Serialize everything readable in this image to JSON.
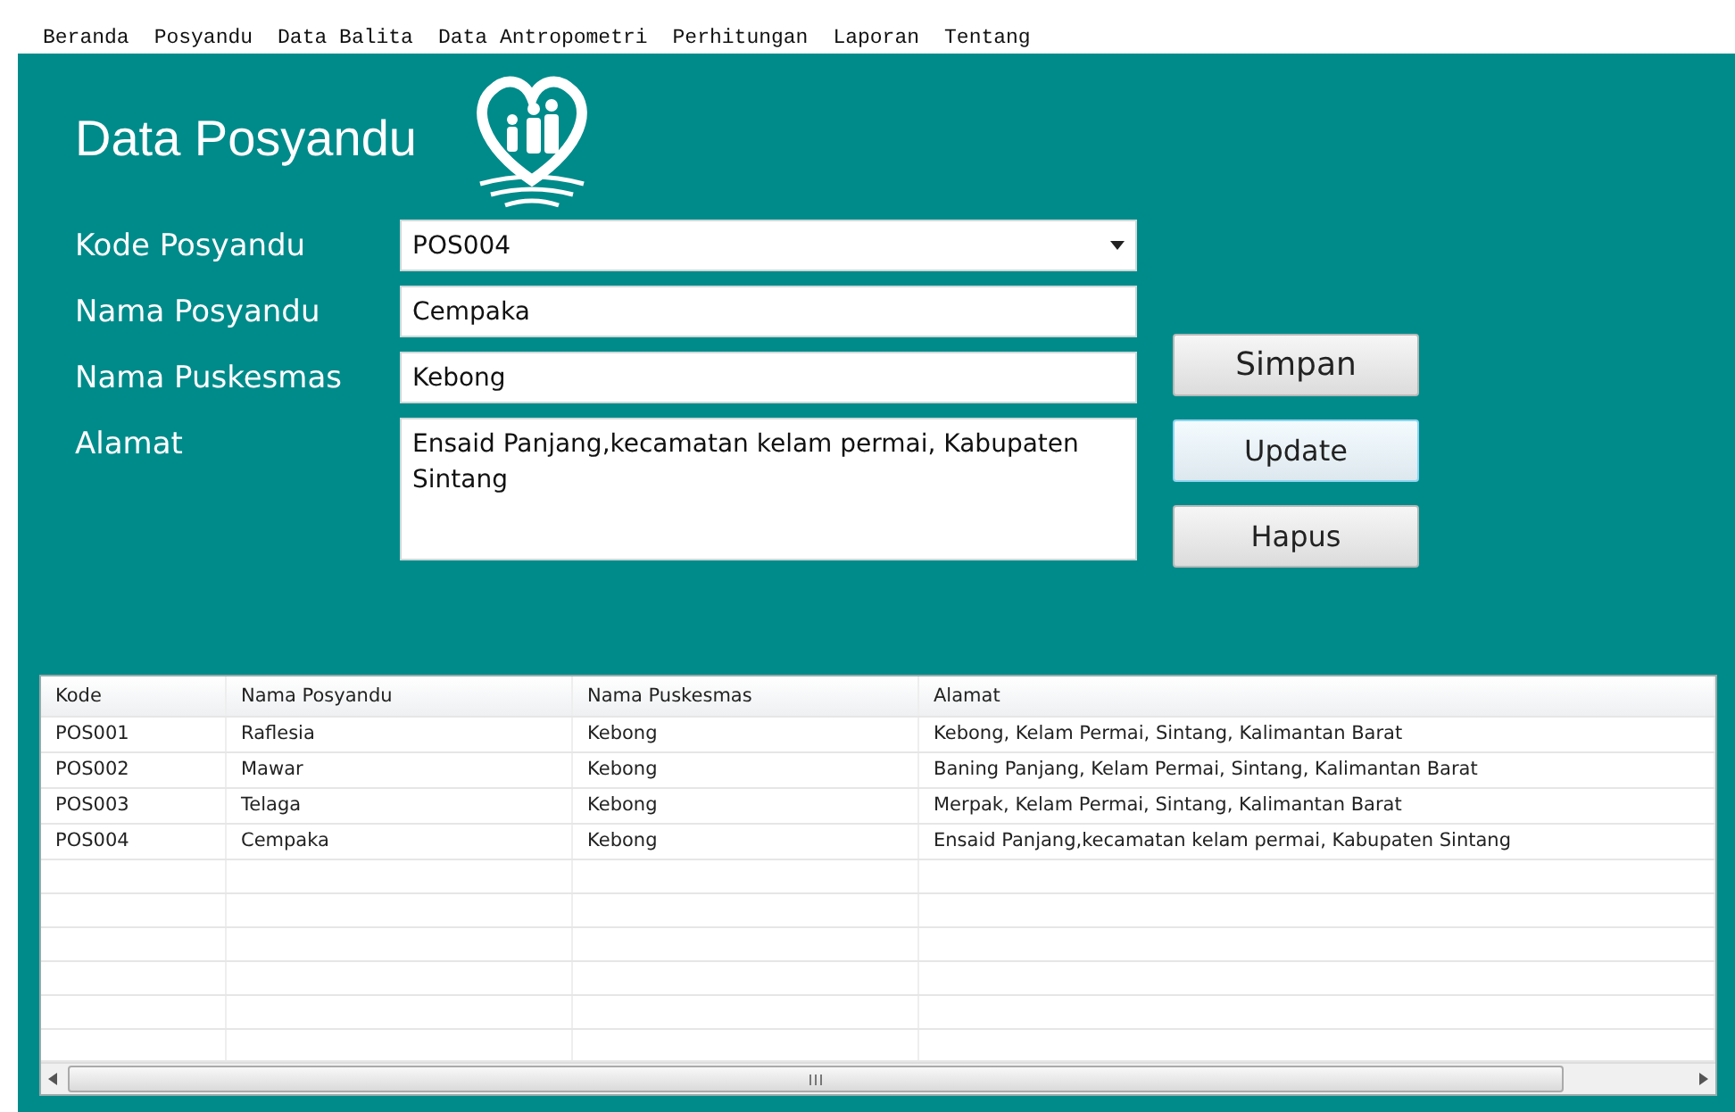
{
  "menu": [
    "Beranda",
    "Posyandu",
    "Data Balita",
    "Data Antropometri",
    "Perhitungan",
    "Laporan",
    "Tentang"
  ],
  "title": "Data Posyandu",
  "form": [
    {
      "label": "Kode Posyandu",
      "kind": "dropdown",
      "value": "POS004"
    },
    {
      "label": "Nama Posyandu",
      "kind": "text",
      "value": "Cempaka"
    },
    {
      "label": "Nama Puskesmas",
      "kind": "text",
      "value": "Kebong"
    },
    {
      "label": "Alamat",
      "kind": "textarea",
      "value": "Ensaid Panjang,kecamatan kelam permai, Kabupaten Sintang"
    }
  ],
  "buttons": [
    {
      "label": "Simpan",
      "focused": false
    },
    {
      "label": "Update",
      "focused": true
    },
    {
      "label": "Hapus",
      "focused": false
    }
  ],
  "table": {
    "columns": [
      "Kode",
      "Nama Posyandu",
      "Nama Puskesmas",
      "Alamat"
    ],
    "rows": [
      [
        "POS001",
        "Raflesia",
        "Kebong",
        "Kebong, Kelam Permai, Sintang, Kalimantan Barat"
      ],
      [
        "POS002",
        "Mawar",
        "Kebong",
        "Baning Panjang, Kelam Permai, Sintang, Kalimantan Barat"
      ],
      [
        "POS003",
        "Telaga",
        "Kebong",
        "Merpak, Kelam Permai, Sintang, Kalimantan Barat"
      ],
      [
        "POS004",
        "Cempaka",
        "Kebong",
        "Ensaid Panjang,kecamatan kelam permai, Kabupaten Sintang"
      ]
    ]
  }
}
